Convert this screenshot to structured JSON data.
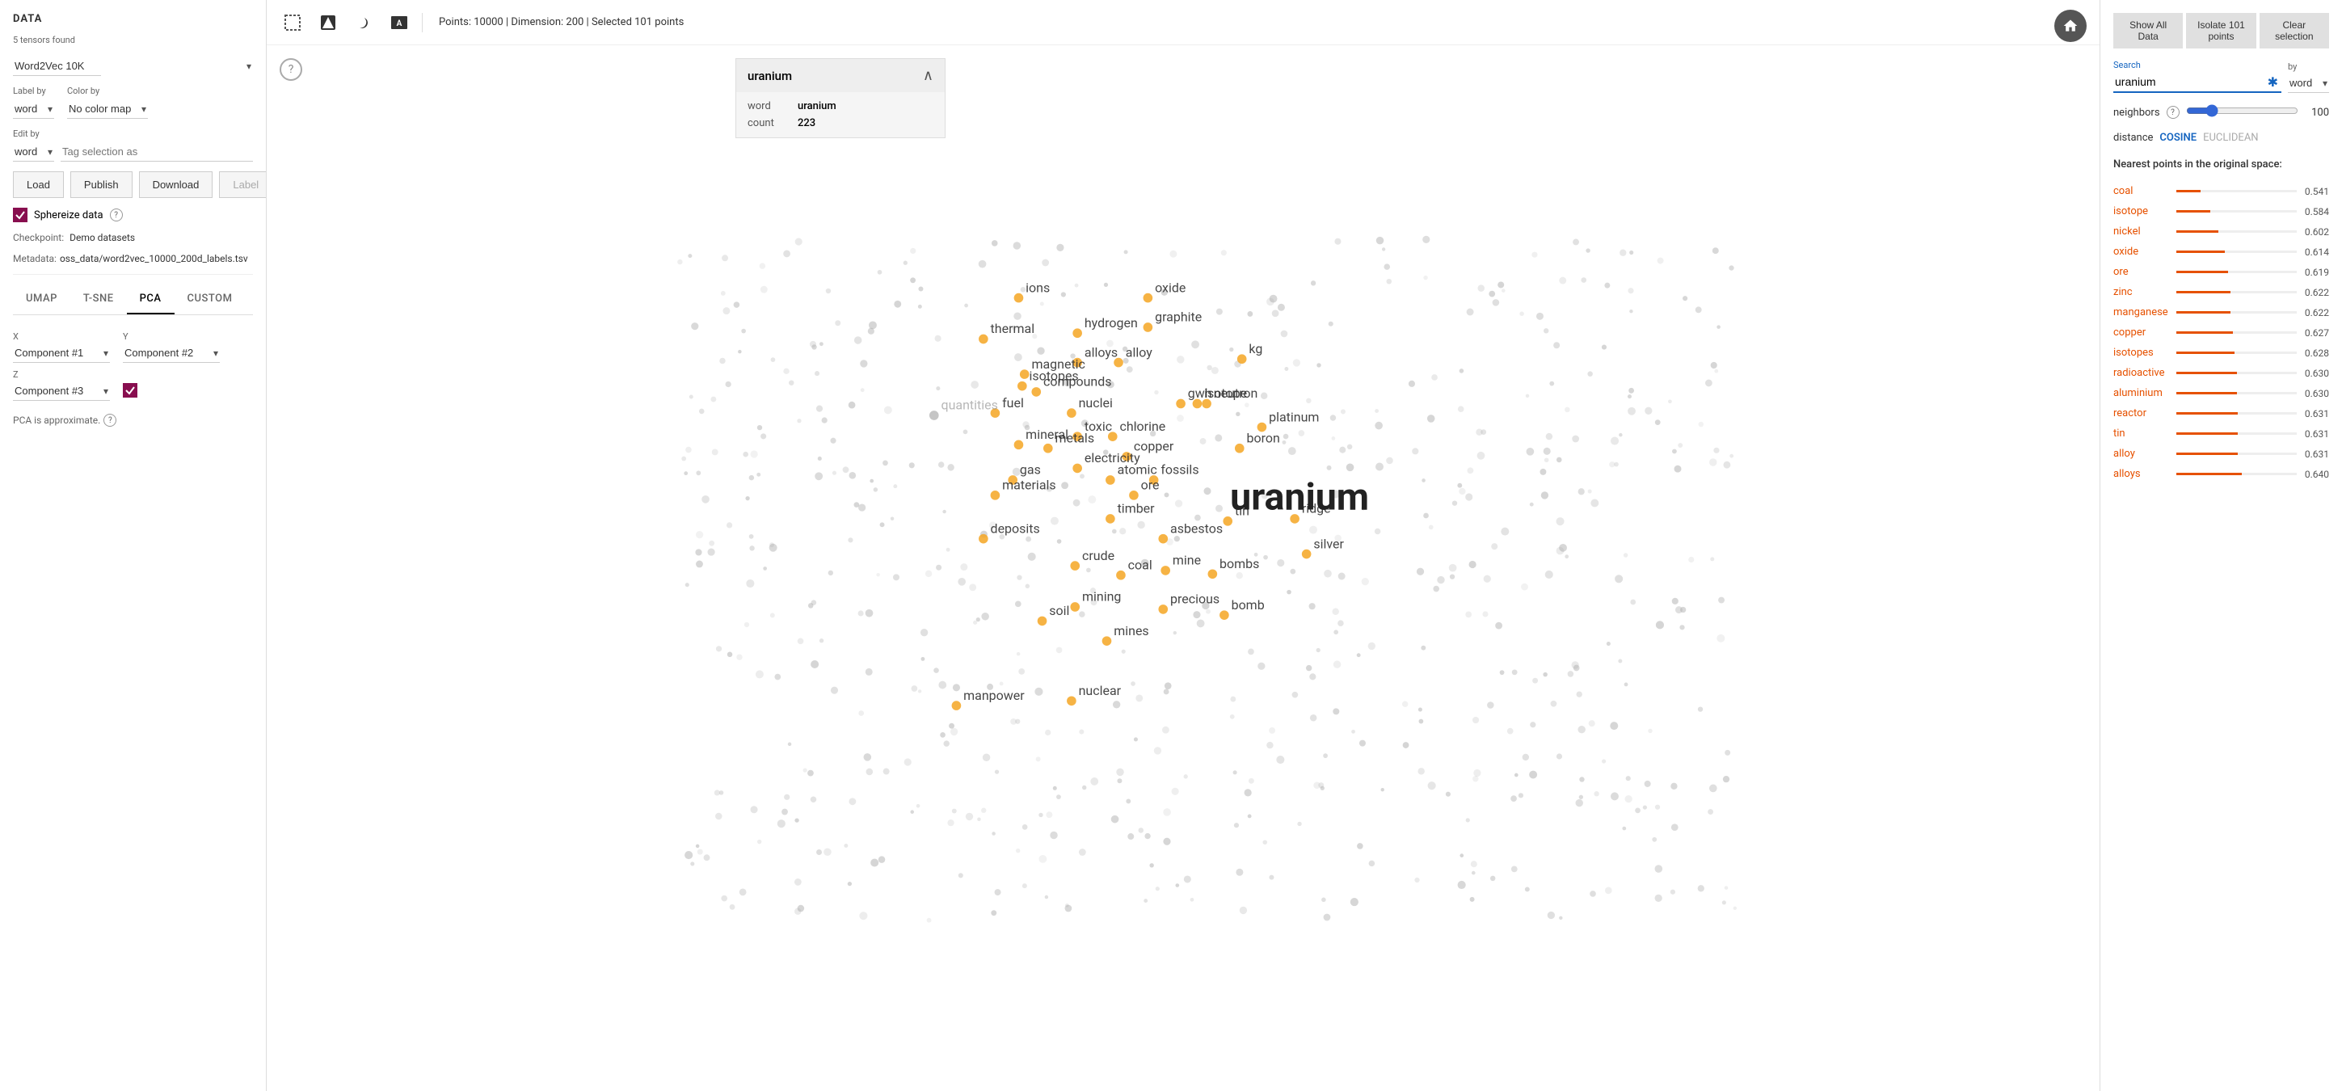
{
  "app": {
    "title": "DATA"
  },
  "left": {
    "tensors_found": "5 tensors found",
    "dataset": "Word2Vec 10K",
    "label_by_label": "Label by",
    "label_by_value": "word",
    "color_by_label": "Color by",
    "color_by_value": "No color map",
    "edit_by_label": "Edit by",
    "edit_by_value": "word",
    "tag_selection_placeholder": "Tag selection as",
    "load_btn": "Load",
    "publish_btn": "Publish",
    "download_btn": "Download",
    "label_btn": "Label",
    "sphereize_label": "Sphereize data",
    "checkpoint_label": "Checkpoint:",
    "checkpoint_value": "Demo datasets",
    "metadata_label": "Metadata:",
    "metadata_value": "oss_data/word2vec_10000_200d_labels.tsv"
  },
  "tabs": [
    "UMAP",
    "T-SNE",
    "PCA",
    "CUSTOM"
  ],
  "active_tab": "PCA",
  "axes": {
    "x_label": "X",
    "x_value": "Component #1",
    "y_label": "Y",
    "y_value": "Component #2",
    "z_label": "Z",
    "z_value": "Component #3"
  },
  "pca_note": "PCA is approximate.",
  "topbar": {
    "points": "Points: 10000",
    "dimension": "Dimension: 200",
    "selected": "Selected 101 points"
  },
  "tooltip": {
    "title": "uranium",
    "word_label": "word",
    "word_value": "uranium",
    "count_label": "count",
    "count_value": "223"
  },
  "right": {
    "show_all_btn": "Show All Data",
    "isolate_btn": "Isolate 101 points",
    "clear_btn": "Clear selection",
    "search_label": "Search",
    "search_value": "uranium",
    "by_label": "by",
    "by_value": "word",
    "neighbors_label": "neighbors",
    "neighbors_value": 100,
    "distance_label": "distance",
    "cosine_label": "COSINE",
    "euclidean_label": "EUCLIDEAN",
    "nearest_title": "Nearest points in the original space:",
    "nearest_points": [
      {
        "name": "coal",
        "score": 0.541,
        "pct": 20
      },
      {
        "name": "isotope",
        "score": 0.584,
        "pct": 28
      },
      {
        "name": "nickel",
        "score": 0.602,
        "pct": 35
      },
      {
        "name": "oxide",
        "score": 0.614,
        "pct": 40
      },
      {
        "name": "ore",
        "score": 0.619,
        "pct": 43
      },
      {
        "name": "zinc",
        "score": 0.622,
        "pct": 45
      },
      {
        "name": "manganese",
        "score": 0.622,
        "pct": 45
      },
      {
        "name": "copper",
        "score": 0.627,
        "pct": 47
      },
      {
        "name": "isotopes",
        "score": 0.628,
        "pct": 48
      },
      {
        "name": "radioactive",
        "score": 0.63,
        "pct": 50
      },
      {
        "name": "aluminium",
        "score": 0.63,
        "pct": 50
      },
      {
        "name": "reactor",
        "score": 0.631,
        "pct": 51
      },
      {
        "name": "tin",
        "score": 0.631,
        "pct": 51
      },
      {
        "name": "alloy",
        "score": 0.631,
        "pct": 51
      },
      {
        "name": "alloys",
        "score": 0.64,
        "pct": 54
      }
    ]
  },
  "scatter": {
    "words_orange": [
      "ions",
      "thermal",
      "hydrogen",
      "graphite",
      "oxide",
      "magnetic",
      "alloys",
      "alloy",
      "compounds",
      "nuclei",
      "fuel",
      "kg",
      "mineral",
      "metals",
      "gas",
      "toxic",
      "chlorine",
      "copper",
      "electricity",
      "atomic",
      "fossils",
      "ore",
      "materials",
      "timber",
      "asbestos",
      "mine",
      "deposits",
      "crude",
      "coal",
      "bombs",
      "mining",
      "precious",
      "bomb",
      "soil",
      "mines",
      "nuclear",
      "manpower",
      "boron",
      "silver",
      "ridge",
      "tin",
      "platinum",
      "gwh",
      "neutron",
      "isotope",
      "isotopes"
    ],
    "words_gray": [
      "quantities"
    ]
  }
}
